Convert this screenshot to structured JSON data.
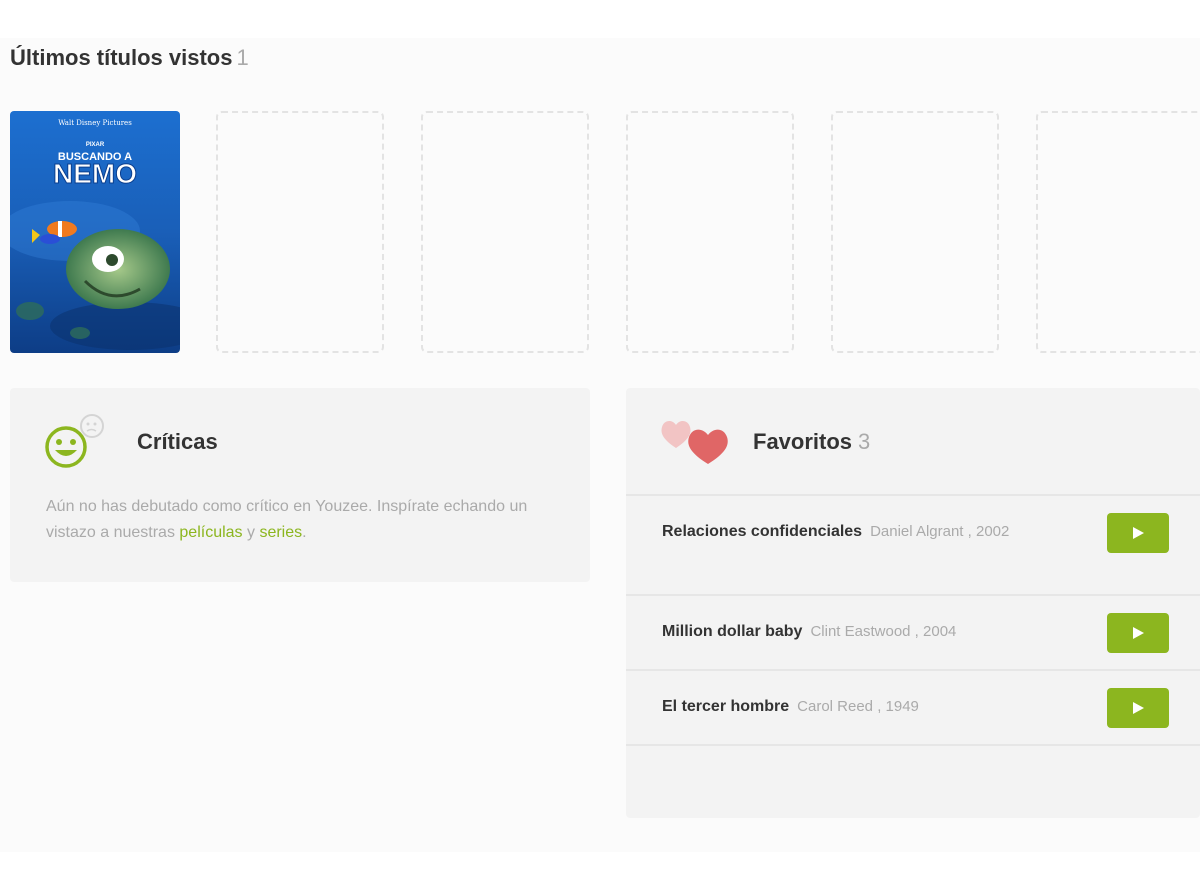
{
  "recent": {
    "title": "Últimos títulos vistos",
    "count": "1",
    "poster_text": {
      "studio": "Walt Disney Pictures",
      "studio2": "PIXAR",
      "title_top": "BUSCANDO A",
      "title_main": "NEMO"
    }
  },
  "criticas": {
    "title": "Críticas",
    "text_before": "Aún no has debutado como crítico en Youzee. Inspírate echando un vistazo a nuestras ",
    "link_peliculas": "películas",
    "text_middle": " y ",
    "link_series": "series",
    "text_after": "."
  },
  "favoritos": {
    "title": "Favoritos",
    "count": "3",
    "items": [
      {
        "title": "Relaciones confidenciales",
        "meta": "Daniel Algrant , 2002"
      },
      {
        "title": "Million dollar baby",
        "meta": "Clint Eastwood , 2004"
      },
      {
        "title": "El tercer hombre",
        "meta": "Carol Reed , 1949"
      }
    ]
  },
  "colors": {
    "accent_green": "#8cb61f",
    "heart_red": "#e06666",
    "heart_pink": "#f2c4c4"
  }
}
